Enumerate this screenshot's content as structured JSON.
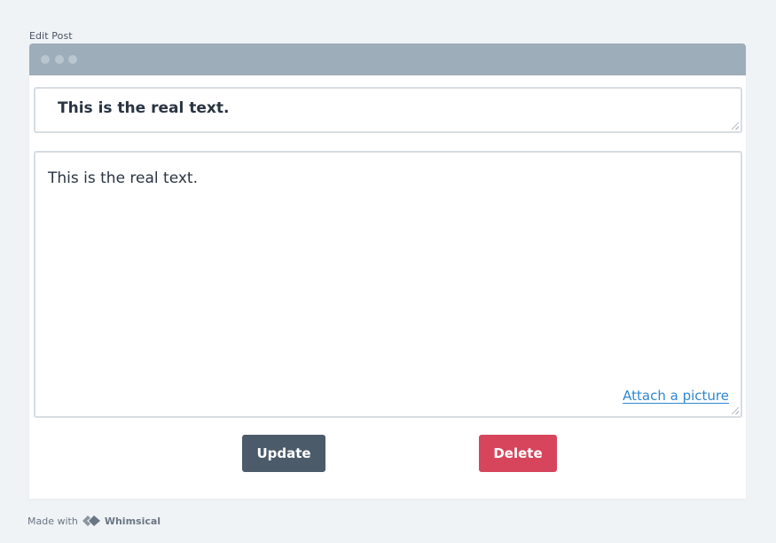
{
  "frame": {
    "label": "Edit Post"
  },
  "title_field": {
    "value": "This is the real text."
  },
  "body_field": {
    "value": "This is the real text.",
    "attach_link": "Attach a picture"
  },
  "actions": {
    "update_label": "Update",
    "delete_label": "Delete"
  },
  "footer": {
    "made_with": "Made with",
    "brand": "Whimsical",
    "brand_icon": "whimsical-logo-icon"
  },
  "colors": {
    "background": "#f0f3f6",
    "titlebar": "#9dadb9",
    "update_button": "#4c5b6a",
    "delete_button": "#d6455c",
    "link": "#2e87d1"
  }
}
